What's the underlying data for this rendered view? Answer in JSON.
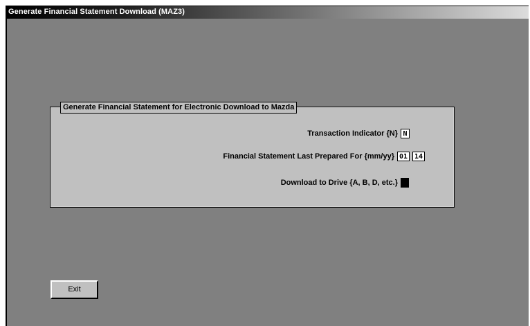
{
  "window": {
    "title": "Generate Financial Statement Download  (MAZ3)"
  },
  "group": {
    "legend": "Generate Financial Statement for Electronic Download to Mazda",
    "fields": {
      "transaction_indicator": {
        "label": "Transaction Indicator {N}",
        "value": "N"
      },
      "last_prepared": {
        "label": "Financial Statement Last Prepared For {mm/yy}",
        "month": "01",
        "year": "14"
      },
      "download_drive": {
        "label": "Download to Drive {A, B, D, etc.}",
        "value": ""
      }
    }
  },
  "buttons": {
    "exit_label": "Exit"
  }
}
